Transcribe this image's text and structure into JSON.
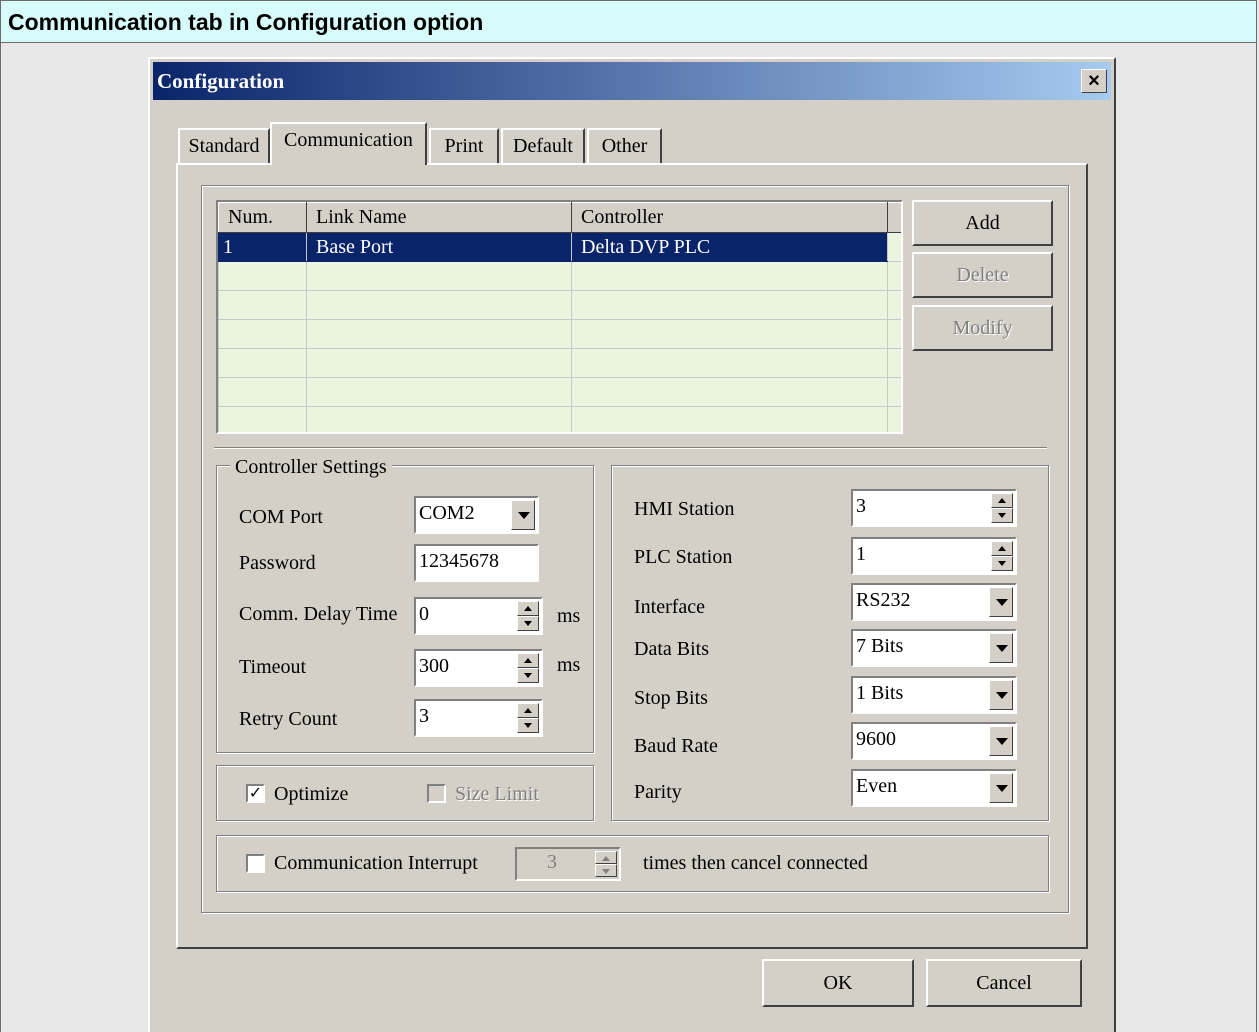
{
  "banner": {
    "title": "Communication tab in Configuration option"
  },
  "dialog": {
    "title": "Configuration",
    "close_label": "×",
    "tabs": [
      {
        "label": "Standard"
      },
      {
        "label": "Communication"
      },
      {
        "label": "Print"
      },
      {
        "label": "Default"
      },
      {
        "label": "Other"
      }
    ],
    "active_tab": "Communication",
    "links_table": {
      "headers": [
        "Num.",
        "Link Name",
        "Controller"
      ],
      "rows": [
        [
          "1",
          "Base Port",
          "Delta DVP PLC"
        ]
      ],
      "selected_row": 0
    },
    "buttons": {
      "add": "Add",
      "delete": "Delete",
      "modify": "Modify",
      "ok": "OK",
      "cancel": "Cancel"
    },
    "controller_settings": {
      "title": "Controller Settings",
      "com_port_label": "COM Port",
      "com_port_value": "COM2",
      "password_label": "Password",
      "password_value": "12345678",
      "comm_delay_label": "Comm. Delay Time",
      "comm_delay_value": "0",
      "comm_delay_unit": "ms",
      "timeout_label": "Timeout",
      "timeout_value": "300",
      "timeout_unit": "ms",
      "retry_label": "Retry Count",
      "retry_value": "3"
    },
    "optimize": {
      "label": "Optimize",
      "checked": true
    },
    "size_limit": {
      "label": "Size Limit",
      "checked": false,
      "enabled": false
    },
    "serial": {
      "hmi_station_label": "HMI Station",
      "hmi_station_value": "3",
      "plc_station_label": "PLC Station",
      "plc_station_value": "1",
      "interface_label": "Interface",
      "interface_value": "RS232",
      "data_bits_label": "Data Bits",
      "data_bits_value": "7 Bits",
      "stop_bits_label": "Stop Bits",
      "stop_bits_value": "1 Bits",
      "baud_rate_label": "Baud Rate",
      "baud_rate_value": "9600",
      "parity_label": "Parity",
      "parity_value": "Even"
    },
    "comm_interrupt": {
      "label": "Communication Interrupt",
      "checked": false,
      "times_value": "3",
      "suffix": "times then cancel connected"
    }
  }
}
